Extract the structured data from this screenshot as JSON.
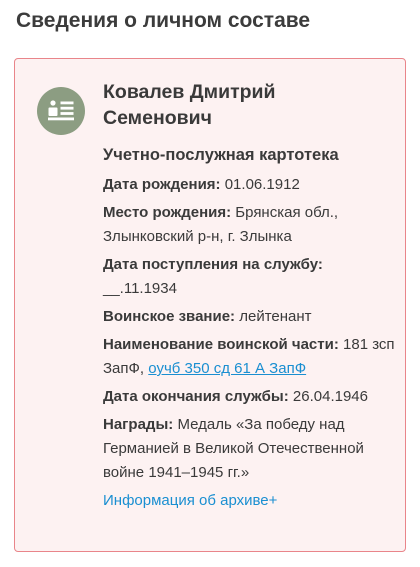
{
  "page_title": "Сведения о личном составе",
  "person": {
    "avatar_icon": "person-card-icon",
    "name_line1": "Ковалев Дмитрий",
    "name_line2": "Семенович"
  },
  "card_title": "Учетно-послужная картотека",
  "fields": {
    "birth_date_label": "Дата рождения:",
    "birth_date_value": "01.06.1912",
    "birth_place_label": "Место рождения:",
    "birth_place_value": "Брянская обл., Злынковский р-н, г. Злынка",
    "service_start_label": "Дата поступления на службу:",
    "service_start_value": "__.11.1934",
    "rank_label": "Воинское звание:",
    "rank_value": "лейтенант",
    "unit_label": "Наименование воинской части:",
    "unit_value": "181 зсп ЗапФ,",
    "unit_link": "оучб 350 сд 61 А ЗапФ",
    "service_end_label": "Дата окончания службы:",
    "service_end_value": "26.04.1946",
    "awards_label": "Награды:",
    "awards_value": "Медаль «За победу над Германией в Великой Отечественной войне 1941–1945 гг.»"
  },
  "archive_link": "Информация об архиве+",
  "colors": {
    "card_border": "#e9858a",
    "card_bg": "#fdf2f2",
    "avatar_bg": "#8c9d82",
    "link": "#1a8fd1"
  }
}
